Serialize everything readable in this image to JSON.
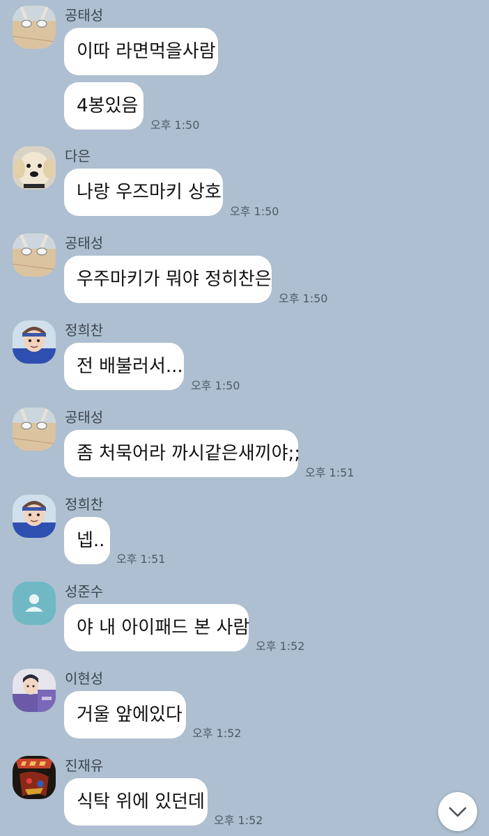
{
  "colors": {
    "background": "#adbfd0",
    "bubble": "#ffffff",
    "text": "#111111",
    "name": "#3d4650",
    "time": "#4e5a66"
  },
  "messages": [
    {
      "sender": "공태성",
      "text": "이따 라면먹을사람",
      "time": ""
    },
    {
      "sender": "",
      "text": "4봉있음",
      "time": "오후 1:50"
    },
    {
      "sender": "다은",
      "text": "나랑 우즈마키 상호",
      "time": "오후 1:50"
    },
    {
      "sender": "공태성",
      "text": "우주마키가 뭐야 정히찬은",
      "time": "오후 1:50"
    },
    {
      "sender": "정희찬",
      "text": "전 배불러서...",
      "time": "오후 1:50"
    },
    {
      "sender": "공태성",
      "text": "좀 처묵어라 까시같은새끼야;;",
      "time": "오후 1:51"
    },
    {
      "sender": "정희찬",
      "text": "넵..",
      "time": "오후 1:51"
    },
    {
      "sender": "성준수",
      "text": "야 내 아이패드 본 사람",
      "time": "오후 1:52"
    },
    {
      "sender": "이현성",
      "text": "거울 앞에있다",
      "time": "오후 1:52"
    },
    {
      "sender": "진재유",
      "text": "식탁 위에 있던데",
      "time": "오후 1:52"
    }
  ],
  "avatars": {
    "공태성": "sneakers-feet-avatar",
    "다은": "puppy-avatar",
    "정희찬": "anime-boy-avatar",
    "성준수": "default-person-icon",
    "이현성": "anime-student-avatar",
    "진재유": "band-logo-avatar"
  },
  "scroll_down_icon": "chevron-down-icon"
}
